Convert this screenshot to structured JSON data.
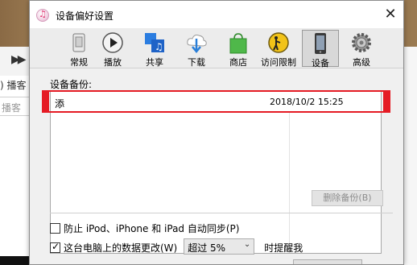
{
  "background_app": {
    "menu_text": ") 播客",
    "search_placeholder": "播客"
  },
  "dialog": {
    "title": "设备偏好设置",
    "close_label": "✕",
    "toolbar": [
      {
        "label": "常规",
        "icon": "general-icon"
      },
      {
        "label": "播放",
        "icon": "playback-icon"
      },
      {
        "label": "共享",
        "icon": "sharing-icon"
      },
      {
        "label": "下载",
        "icon": "download-icon"
      },
      {
        "label": "商店",
        "icon": "store-icon"
      },
      {
        "label": "访问限制",
        "icon": "restrictions-icon"
      },
      {
        "label": "设备",
        "icon": "device-icon",
        "active": true
      },
      {
        "label": "高级",
        "icon": "advanced-icon"
      }
    ],
    "backups": {
      "label": "设备备份:",
      "rows": [
        {
          "name": "添",
          "date": "2018/10/2 15:25"
        }
      ],
      "delete_button": "删除备份(B)"
    },
    "options": {
      "prevent_sync_label": "防止 iPod、iPhone 和 iPad 自动同步(P)",
      "prevent_sync_checked": false,
      "warn_label": "这台电脑上的数据更改(W)",
      "warn_checked": true,
      "warn_select_value": "超过 5%",
      "warn_suffix": "时提醒我"
    }
  },
  "colors": {
    "highlight": "#e51b24",
    "dialog_bg": "#f0f0f0"
  }
}
